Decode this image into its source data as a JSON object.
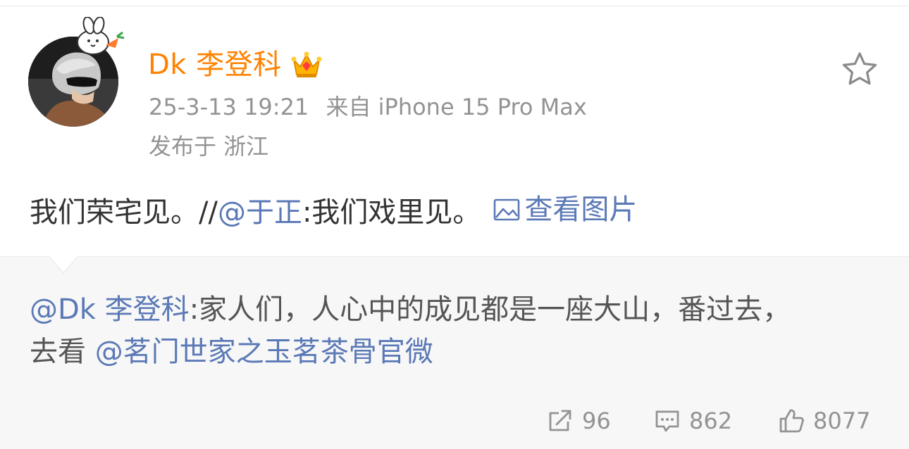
{
  "post": {
    "user_name": "Dk 李登科",
    "timestamp": "25-3-13 19:21",
    "source": "来自 iPhone 15 Pro Max",
    "location": "发布于 浙江",
    "text_prefix": "我们荣宅见。//",
    "mention": "@于正",
    "text_suffix": ":我们戏里见。",
    "view_image_label": "查看图片"
  },
  "quote": {
    "mention_author": "@Dk 李登科",
    "line1_text": ":家人们，人心中的成见都是一座大山，番过去，",
    "line2_prefix": "去看 ",
    "line2_mention": "@茗门世家之玉茗茶骨官微"
  },
  "actions": {
    "repost_count": "96",
    "comment_count": "862",
    "like_count": "8077"
  },
  "colors": {
    "brand_orange": "#ff8200",
    "link_blue": "#5b79b6",
    "meta_gray": "#939393",
    "quote_bg": "#f7f7f7"
  },
  "icons": {
    "favorite": "star-icon",
    "repost": "repost-icon",
    "comment": "comment-icon",
    "like": "thumbs-up-icon",
    "view_image": "image-icon",
    "badge": "crown-icon"
  }
}
